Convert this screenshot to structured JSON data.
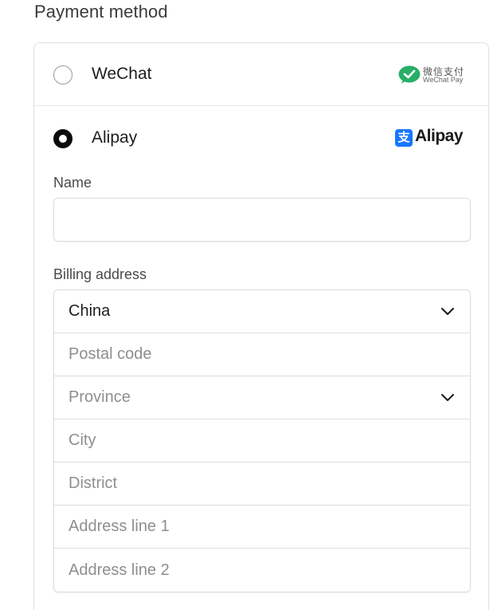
{
  "section": {
    "title": "Payment method"
  },
  "options": {
    "wechat": {
      "label": "WeChat",
      "logo_cn": "微信支付",
      "logo_en": "WeChat Pay",
      "selected": false
    },
    "alipay": {
      "label": "Alipay",
      "logo_glyph": "支",
      "logo_text": "Alipay",
      "selected": true
    }
  },
  "form": {
    "name_label": "Name",
    "name_value": "",
    "billing_label": "Billing address",
    "country_value": "China",
    "postal_placeholder": "Postal code",
    "province_placeholder": "Province",
    "city_placeholder": "City",
    "district_placeholder": "District",
    "address1_placeholder": "Address line 1",
    "address2_placeholder": "Address line 2"
  },
  "icons": {
    "wechat_logo": "wechat-pay-icon",
    "alipay_logo": "alipay-icon",
    "country_chevron": "chevron-down-icon",
    "province_chevron": "chevron-down-icon"
  },
  "colors": {
    "wechat_green": "#2aae67",
    "alipay_blue": "#1677ff",
    "radio_checked": "#0a0a0a",
    "border": "#dcdcde"
  }
}
